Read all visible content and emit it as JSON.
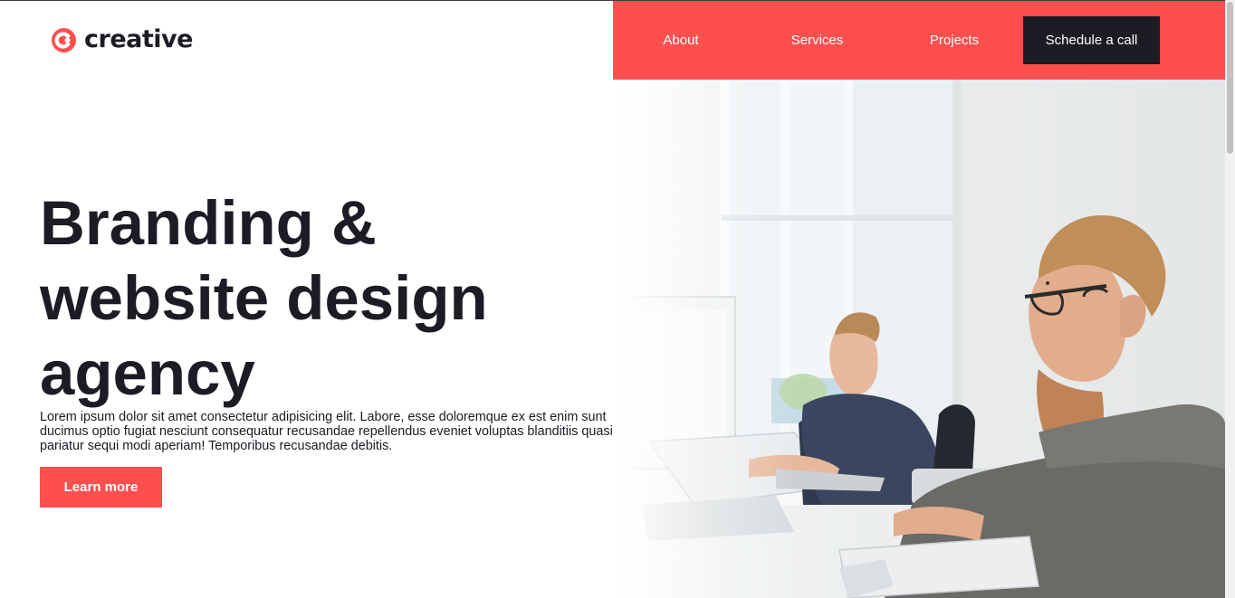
{
  "brand": {
    "name": "creative",
    "logo_icon": "c-logo-icon",
    "accent_color": "#fe4f4f",
    "dark_color": "#1b1c24"
  },
  "nav": {
    "items": [
      {
        "label": "About"
      },
      {
        "label": "Services"
      },
      {
        "label": "Projects"
      }
    ],
    "cta_label": "Schedule a call"
  },
  "hero": {
    "title": "Branding & website design agency",
    "description": "Lorem ipsum dolor sit amet consectetur adipisicing elit. Labore, esse doloremque ex est enim sunt ducimus optio fugiat nesciunt consequatur recusandae repellendus eveniet voluptas blanditiis quasi pariatur sequi modi aperiam! Temporibus recusandae debitis.",
    "button_label": "Learn more",
    "image": "office-workers-photo"
  }
}
